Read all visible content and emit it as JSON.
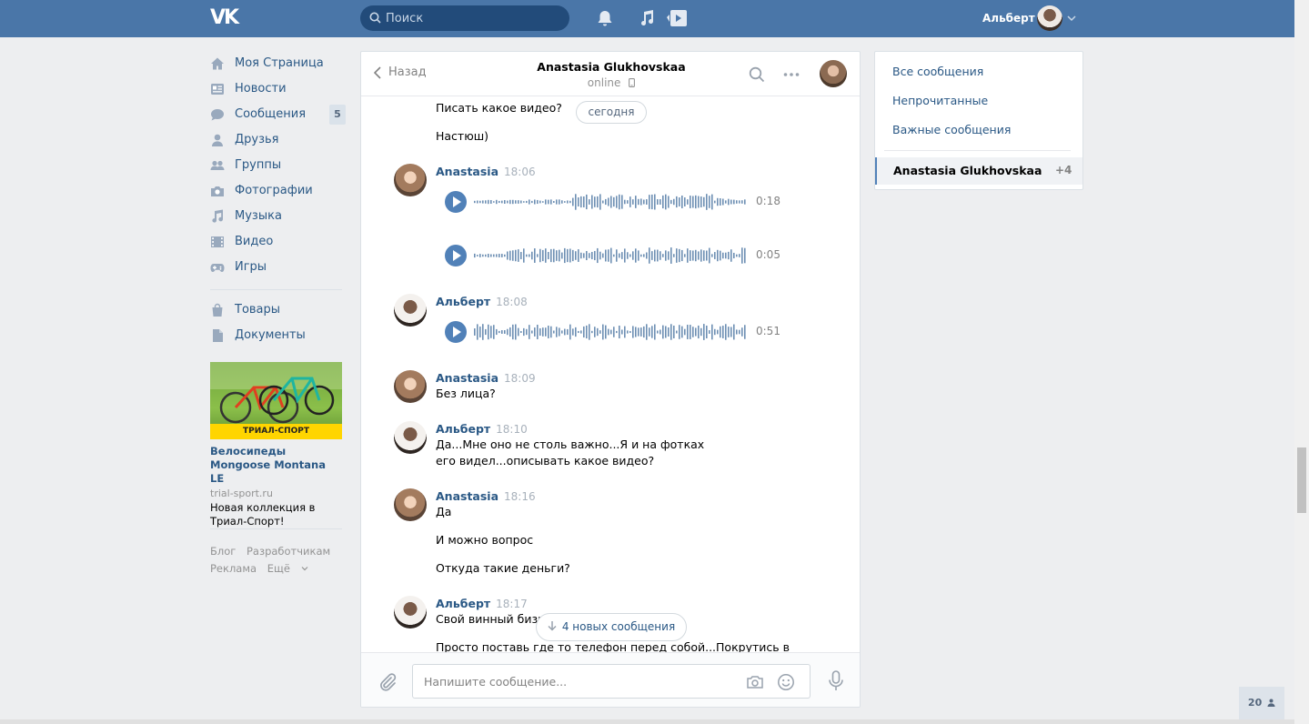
{
  "header": {
    "logo": "VK",
    "search_placeholder": "Поиск",
    "user_name": "Альберт"
  },
  "nav": {
    "items": [
      {
        "label": "Моя Страница",
        "icon": "home-icon"
      },
      {
        "label": "Новости",
        "icon": "news-icon"
      },
      {
        "label": "Сообщения",
        "icon": "messages-icon",
        "badge": "5"
      },
      {
        "label": "Друзья",
        "icon": "friends-icon"
      },
      {
        "label": "Группы",
        "icon": "groups-icon"
      },
      {
        "label": "Фотографии",
        "icon": "camera-icon"
      },
      {
        "label": "Музыка",
        "icon": "music-icon"
      },
      {
        "label": "Видео",
        "icon": "video-icon"
      },
      {
        "label": "Игры",
        "icon": "games-icon"
      }
    ],
    "extra": [
      {
        "label": "Товары",
        "icon": "bag-icon"
      },
      {
        "label": "Документы",
        "icon": "document-icon"
      }
    ]
  },
  "ad": {
    "banner": "ТРИАЛ-СПОРТ",
    "title": "Велосипеды Mongoose Montana LE",
    "domain": "trial-sport.ru",
    "text": "Новая коллекция в Триал-Спорт!"
  },
  "footer": {
    "links": [
      "Блог",
      "Разработчикам",
      "Реклама",
      "Ещё"
    ]
  },
  "chat": {
    "back_label": "Назад",
    "name": "Anastasia Glukhovskaa",
    "status": "online",
    "date_pill": "сегодня",
    "new_messages": "4 новых сообщения",
    "input_placeholder": "Напишите сообщение...",
    "messages": {
      "m0": {
        "text1": "Писать какое видео?",
        "text2": "Настюш)"
      },
      "m1": {
        "author": "Anastasia",
        "time": "18:06",
        "voice1": "0:18",
        "voice2": "0:05"
      },
      "m2": {
        "author": "Альберт",
        "time": "18:08",
        "voice1": "0:51"
      },
      "m3": {
        "author": "Anastasia",
        "time": "18:09",
        "text1": "Без лица?"
      },
      "m4": {
        "author": "Альберт",
        "time": "18:10",
        "text1": "Да...Мне оно не столь важно...Я и на фотках его видел...описывать какое видео?"
      },
      "m5": {
        "author": "Anastasia",
        "time": "18:16",
        "text1": "Да",
        "text2": "И можно вопрос",
        "text3": "Откуда такие деньги?"
      },
      "m6": {
        "author": "Альберт",
        "time": "18:17",
        "text1": "Свой винный бизнес",
        "text2": "Просто поставь где то телефон перед собой...Покрутись в"
      }
    }
  },
  "right_panel": {
    "all": "Все сообщения",
    "unread": "Непрочитанные",
    "important": "Важные сообщения",
    "active_name": "Anastasia Glukhovskaa",
    "active_count": "+4"
  },
  "online_count": "20",
  "colors": {
    "header": "#4a76a8",
    "link": "#2a5885",
    "accent": "#5181b8",
    "background": "#edeef0"
  }
}
